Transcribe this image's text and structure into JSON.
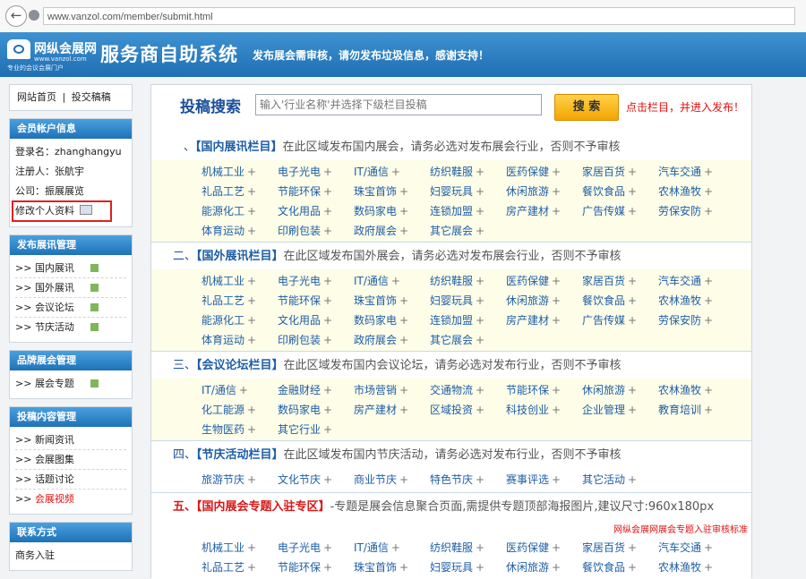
{
  "browser": {
    "url": "www.vanzol.com/member/submit.html"
  },
  "header": {
    "logo_name": "网纵会展网",
    "logo_url": "www.vanzol.com",
    "logo_slogan": "专业的会议会展门户",
    "system_title": "服务商自助系统",
    "notice": "发布展会需审核，请勿发布垃圾信息，感谢支持！"
  },
  "sidebar": {
    "nav": {
      "home": "网站首页",
      "sep": "|",
      "submit": "投交稿稿"
    },
    "account": {
      "title": "会员帐户信息",
      "login": "登录名：zhanghangyu",
      "registrant": "注册人：张航宇",
      "company": "公司：振展展览",
      "edit_profile": "修改个人资料"
    },
    "publish": {
      "title": "发布展讯管理",
      "items": [
        "国内展讯",
        "国外展讯",
        "会议论坛",
        "节庆活动"
      ]
    },
    "brand": {
      "title": "品牌展会管理",
      "items": [
        "展会专题"
      ]
    },
    "content": {
      "title": "投稿内容管理",
      "items": [
        "新闻资讯",
        "会展图集",
        "话题讨论",
        "会展视频"
      ]
    },
    "contact": {
      "title": "联系方式",
      "items": [
        "商务入驻"
      ]
    }
  },
  "search": {
    "title": "投稿搜索",
    "placeholder": "输入'行业名称'并选择下级栏目投稿",
    "button": "搜 索",
    "hint": "点击栏目，并进入发布！"
  },
  "sections": [
    {
      "num": "、",
      "name": "【国内展讯栏目】",
      "desc": "在此区域发布国内展会，请务必选对发布展会行业，否则不予审核",
      "cats": [
        "机械工业",
        "电子光电",
        "IT/通信",
        "纺织鞋服",
        "医药保健",
        "家居百货",
        "汽车交通",
        "礼品工艺",
        "节能环保",
        "珠宝首饰",
        "妇婴玩具",
        "休闲旅游",
        "餐饮食品",
        "农林渔牧",
        "能源化工",
        "文化用品",
        "数码家电",
        "连锁加盟",
        "房产建材",
        "广告传媒",
        "劳保安防",
        "体育运动",
        "印刷包装",
        "政府展会",
        "其它展会"
      ]
    },
    {
      "num": "二、",
      "name": "【国外展讯栏目】",
      "desc": "在此区域发布国外展会，请务必选对发布展会行业，否则不予审核",
      "cats": [
        "机械工业",
        "电子光电",
        "IT/通信",
        "纺织鞋服",
        "医药保健",
        "家居百货",
        "汽车交通",
        "礼品工艺",
        "节能环保",
        "珠宝首饰",
        "妇婴玩具",
        "休闲旅游",
        "餐饮食品",
        "农林渔牧",
        "能源化工",
        "文化用品",
        "数码家电",
        "连锁加盟",
        "房产建材",
        "广告传媒",
        "劳保安防",
        "体育运动",
        "印刷包装",
        "政府展会",
        "其它展会"
      ]
    },
    {
      "num": "三、",
      "name": "【会议论坛栏目】",
      "desc": "在此区域发布国内会议论坛，请务必选对发布行业，否则不予审核",
      "cats": [
        "IT/通信",
        "金融财经",
        "市场营销",
        "交通物流",
        "节能环保",
        "休闲旅游",
        "农林渔牧",
        "化工能源",
        "数码家电",
        "房产建材",
        "区域投资",
        "科技创业",
        "企业管理",
        "教育培训",
        "生物医药",
        "其它行业"
      ]
    },
    {
      "num": "四、",
      "name": "【节庆活动栏目】",
      "desc": "在此区域发布国内节庆活动，请务必选对发布行业，否则不予审核",
      "cats": [
        "旅游节庆",
        "文化节庆",
        "商业节庆",
        "特色节庆",
        "赛事评选",
        "其它活动"
      ]
    },
    {
      "num": "五、",
      "name": "【国内展会专题入驻专区】",
      "desc": "-专题是展会信息聚合页面,需提供专题顶部海报图片,建议尺寸:960x180px",
      "note": "网纵会展网展会专题入驻审核标准",
      "cats": [
        "机械工业",
        "电子光电",
        "IT/通信",
        "纺织鞋服",
        "医药保健",
        "家居百货",
        "汽车交通",
        "礼品工艺",
        "节能环保",
        "珠宝首饰",
        "妇婴玩具",
        "休闲旅游",
        "餐饮食品",
        "农林渔牧"
      ]
    }
  ],
  "colors": {
    "accent": "#1e6fb4",
    "link": "#1e5ea6",
    "alert": "#e01010",
    "button": "#f4a400"
  }
}
